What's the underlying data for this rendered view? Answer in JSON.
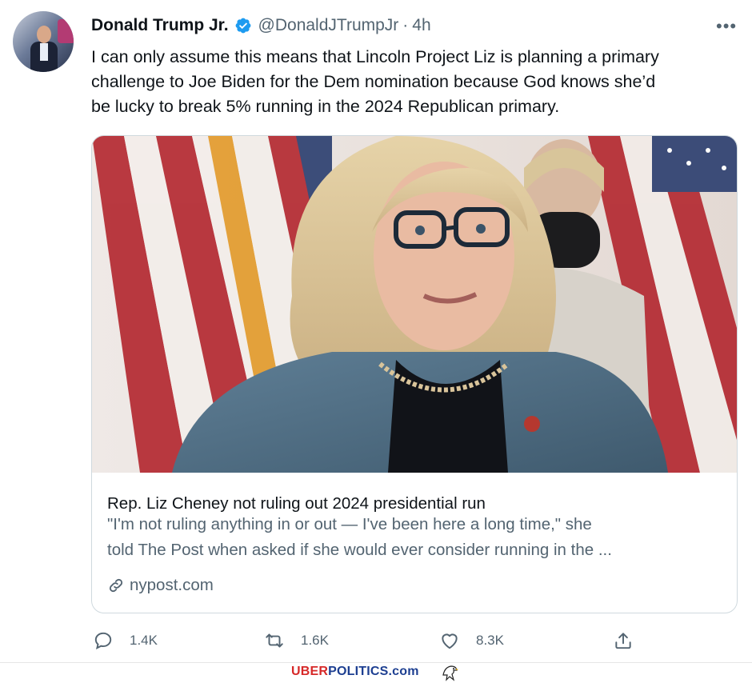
{
  "tweet": {
    "author_name": "Donald Trump Jr.",
    "handle": "@DonaldJTrumpJr",
    "separator": "·",
    "time": "4h",
    "more_label": "•••",
    "text_lines": [
      "I can only assume this means that Lincoln Project Liz is planning a primary",
      "challenge to Joe Biden for the Dem nomination because God knows she’d",
      "be lucky to break 5% running in the 2024 Republican primary."
    ],
    "verified_color": "#1d9bf0"
  },
  "card": {
    "title": "Rep. Liz Cheney not ruling out 2024 presidential run",
    "description_lines": [
      "\"I'm not ruling anything in or out — I've been here a long time,\" she",
      "told The Post when asked if she would ever consider running in the ..."
    ],
    "domain": "nypost.com",
    "link_icon": "link-icon"
  },
  "actions": {
    "reply_count": "1.4K",
    "retweet_count": "1.6K",
    "like_count": "8.3K",
    "icons": [
      "reply-icon",
      "retweet-icon",
      "like-icon",
      "share-icon"
    ]
  },
  "watermark": {
    "part1": "UBER",
    "part2": "POLITICS",
    "part3": ".com",
    "icon": "eagle-icon",
    "colors": {
      "red": "#d62828",
      "blue": "#1d3f91"
    }
  }
}
